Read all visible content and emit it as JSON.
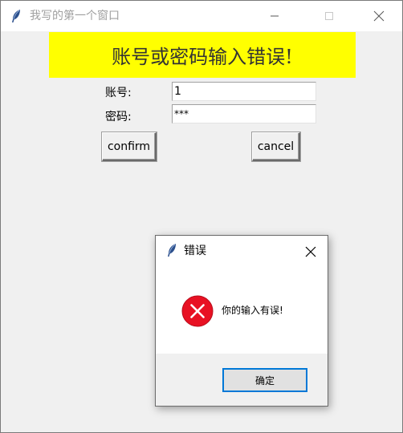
{
  "window": {
    "title": "我写的第一个窗口",
    "icon": "feather-icon"
  },
  "main": {
    "banner_text": "账号或密码输入错误!",
    "banner_color": "#ffff00",
    "account_label": "账号:",
    "account_value": "1",
    "password_label": "密码:",
    "password_value": "***",
    "confirm_label": "confirm",
    "cancel_label": "cancel"
  },
  "dialog": {
    "title": "错误",
    "message": "你的输入有误!",
    "ok_label": "确定",
    "icon": "error-icon",
    "accent_color": "#0078d7",
    "error_color": "#e81123"
  }
}
